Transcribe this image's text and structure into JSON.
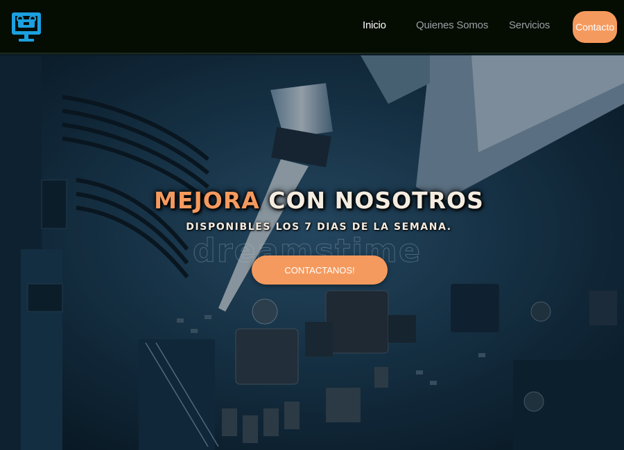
{
  "nav": {
    "logo_icon": "monitor-tools-icon",
    "links": [
      {
        "label": "Inicio",
        "active": true
      },
      {
        "label": "Quienes Somos",
        "active": false
      },
      {
        "label": "Servicios",
        "active": false
      }
    ],
    "contact_label": "Contacto"
  },
  "hero": {
    "background_image": "circuit-board-repair-photo",
    "headline_accent": "MEJORA",
    "headline_rest": " CON NOSOTROS",
    "subheadline": "DISPONIBLES LOS 7 DIAS DE LA SEMANA.",
    "watermark": "dreamstime",
    "cta_label": "CONTACTANOS!"
  },
  "colors": {
    "accent": "#f59a5e",
    "navbar_bg": "#050c02",
    "logo_blue": "#1ba0e0",
    "hero_overlay": "#0d2a3c"
  }
}
